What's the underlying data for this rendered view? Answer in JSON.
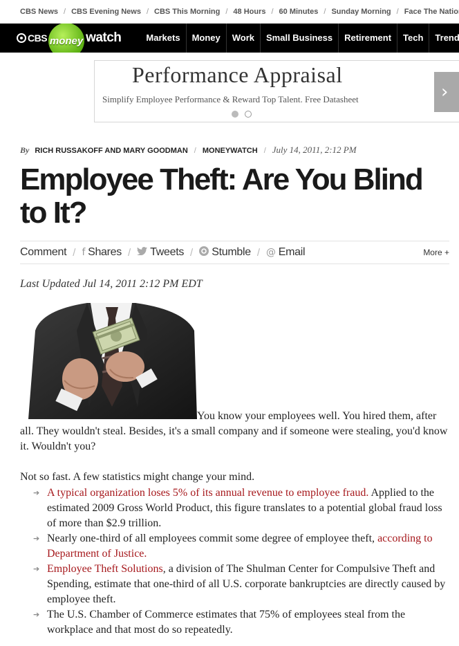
{
  "topnav": [
    "CBS News",
    "CBS Evening News",
    "CBS This Morning",
    "48 Hours",
    "60 Minutes",
    "Sunday Morning",
    "Face The Nation"
  ],
  "logo": {
    "cbs": "CBS",
    "money": "money",
    "watch": "watch"
  },
  "mainnav": [
    "Markets",
    "Money",
    "Work",
    "Small Business",
    "Retirement",
    "Tech",
    "Trending"
  ],
  "ad": {
    "title": "Performance Appraisal",
    "subtitle": "Simplify Employee Performance & Reward Top Talent. Free Datasheet",
    "arrow": "›"
  },
  "byline": {
    "by": "By",
    "authors": "RICH RUSSAKOFF AND MARY GOODMAN",
    "section": "MONEYWATCH",
    "date": "July 14, 2011, 2:12 PM"
  },
  "headline": "Employee Theft: Are You Blind to It?",
  "share": {
    "comment": "Comment",
    "shares": "Shares",
    "tweets": "Tweets",
    "stumble": "Stumble",
    "email": "Email",
    "more": "More +"
  },
  "updated": "Last Updated Jul 14, 2011 2:12 PM EDT",
  "body": {
    "p1": "You know your employees well. You hired them, after all. They wouldn't steal. Besides, it's a small company and if someone were stealing, you'd know it. Wouldn't you?",
    "p2": "Not so fast. A few statistics might change your mind.",
    "bullet1_link": "A typical organization loses 5% of its annual revenue to employee fraud.",
    "bullet1_rest": " Applied to the estimated 2009 Gross World Product, this figure translates to a potential global fraud loss of more than $2.9 trillion.",
    "bullet2_text": "Nearly one-third of all employees commit some degree of employee theft, ",
    "bullet2_link": "according to Department of Justice.",
    "bullet3_link": "Employee Theft Solutions",
    "bullet3_rest": ", a division of The Shulman Center for Compulsive Theft and Spending, estimate that one-third of all U.S. corporate bankruptcies are directly caused by employee theft.",
    "bullet4_text": "The U.S. Chamber of Commerce estimates that 75% of employees steal from the workplace and that most do so repeatedly."
  },
  "colors": {
    "link": "#a6181c",
    "logo_green": "#5cb012",
    "nav_bg": "#000000"
  }
}
